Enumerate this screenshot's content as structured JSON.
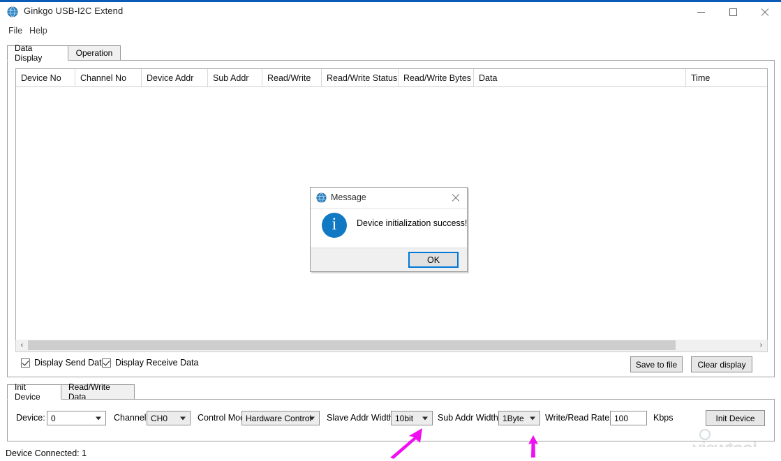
{
  "window": {
    "title": "Ginkgo USB-I2C Extend",
    "app_icon": "app-globe-icon",
    "minimize": "—",
    "maximize": "□",
    "close": "✕"
  },
  "menubar": {
    "items": [
      {
        "label": "File"
      },
      {
        "label": "Help"
      }
    ]
  },
  "top_tabs": [
    {
      "label": "Data Display",
      "active": true
    },
    {
      "label": "Operation",
      "active": false
    }
  ],
  "grid": {
    "columns": [
      {
        "label": "Device No"
      },
      {
        "label": "Channel No"
      },
      {
        "label": "Device Addr"
      },
      {
        "label": "Sub Addr"
      },
      {
        "label": "Read/Write"
      },
      {
        "label": "Read/Write Status"
      },
      {
        "label": "Read/Write Bytes"
      },
      {
        "label": "Data"
      },
      {
        "label": "Time"
      }
    ],
    "rows": []
  },
  "scrollbar": {
    "left_arrow": "‹",
    "right_arrow": "›"
  },
  "display_options": [
    {
      "label": "Display Send Data",
      "checked": true
    },
    {
      "label": "Display Receive Data",
      "checked": true
    }
  ],
  "grid_buttons": {
    "save_to_file": "Save to file",
    "clear_display": "Clear display"
  },
  "bottom_tabs": [
    {
      "label": "Init Device",
      "active": true
    },
    {
      "label": "Read/Write Data",
      "active": false
    }
  ],
  "init_device_panel": {
    "device_label": "Device:",
    "device_value": "0",
    "channel_label": "Channel:",
    "channel_value": "CH0",
    "control_mode_label": "Control Mode:",
    "control_mode_value": "Hardware Control",
    "slave_addr_width_label": "Slave Addr Width:",
    "slave_addr_width_value": "10bit",
    "sub_addr_width_label": "Sub Addr Width:",
    "sub_addr_width_value": "1Byte",
    "rate_label": "Write/Read Rate:",
    "rate_value": "100",
    "rate_unit": "Kbps",
    "init_button": "Init Device"
  },
  "statusbar": {
    "text": "Device Connected: 1"
  },
  "dialog": {
    "title": "Message",
    "icon": "app-globe-icon",
    "close": "✕",
    "info_glyph": "i",
    "message": "Device initialization success!",
    "ok_button": "OK"
  },
  "watermark": {
    "text": "viewtool"
  },
  "annotations": {
    "arrow_color": "#f00ff0",
    "arrow_1_target": "slave-addr-width-combo",
    "arrow_2_target": "sub-addr-width-combo"
  },
  "colors": {
    "accent": "#0a5bb5",
    "info_blue": "#1179c4",
    "focus_blue": "#0078d7",
    "annotation_magenta": "#f00ff0"
  }
}
